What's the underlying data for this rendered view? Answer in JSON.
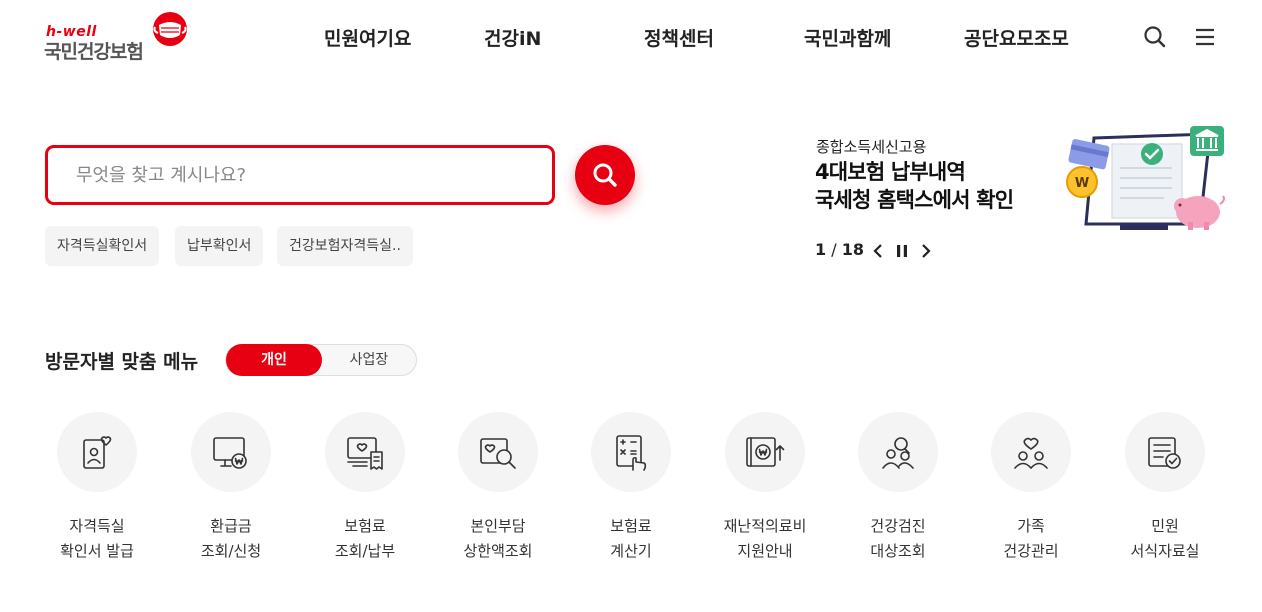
{
  "header": {
    "logo_tag": "h-well",
    "logo_name": "국민건강보험",
    "nav": [
      "민원여기요",
      "건강iN",
      "정책센터",
      "국민과함께",
      "공단요모조모"
    ]
  },
  "search": {
    "placeholder": "무엇을 찾고 계시나요?",
    "keywords": [
      "자격득실확인서",
      "납부확인서",
      "건강보험자격득실.."
    ]
  },
  "banner": {
    "subtitle": "종합소득세신고용",
    "title_line1": "4대보험 납부내역",
    "title_line2": "국세청 홈택스에서 확인",
    "page_current": "1",
    "page_sep": " / ",
    "page_total": "18"
  },
  "visitor_menu": {
    "title": "방문자별 맞춤 메뉴",
    "tabs": [
      "개인",
      "사업장"
    ],
    "items": [
      {
        "line1": "자격득실",
        "line2": "확인서 발급",
        "icon": "id-card-heart-icon"
      },
      {
        "line1": "환급금",
        "line2": "조회/신청",
        "icon": "monitor-won-icon"
      },
      {
        "line1": "보험료",
        "line2": "조회/납부",
        "icon": "receipt-heart-icon"
      },
      {
        "line1": "본인부담",
        "line2": "상한액조회",
        "icon": "search-heart-icon"
      },
      {
        "line1": "보험료",
        "line2": "계산기",
        "icon": "calculator-icon"
      },
      {
        "line1": "재난적의료비",
        "line2": "지원안내",
        "icon": "won-transfer-icon"
      },
      {
        "line1": "건강검진",
        "line2": "대상조회",
        "icon": "checkup-people-icon"
      },
      {
        "line1": "가족",
        "line2": "건강관리",
        "icon": "family-heart-icon"
      },
      {
        "line1": "민원",
        "line2": "서식자료실",
        "icon": "document-check-icon"
      }
    ]
  },
  "colors": {
    "accent": "#e60012",
    "chip_bg": "#f4f4f4",
    "circle_bg": "#f4f4f4"
  }
}
